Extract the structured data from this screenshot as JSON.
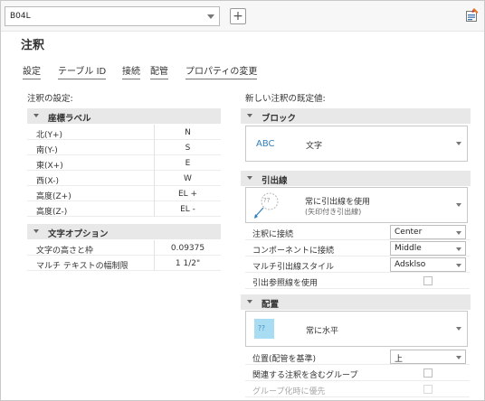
{
  "header": {
    "style_dropdown_value": "B04L",
    "add_button_label": "+",
    "corner_icon": "annotation-style-icon"
  },
  "title": "注釈",
  "tabs": [
    "設定",
    "テーブル ID",
    "接続",
    "配管",
    "プロパティの変更"
  ],
  "left": {
    "heading": "注釈の設定:",
    "coord_label_header": "座標ラベル",
    "coord_rows": [
      {
        "label": "北(Y+)",
        "value": "N"
      },
      {
        "label": "南(Y-)",
        "value": "S"
      },
      {
        "label": "東(X+)",
        "value": "E"
      },
      {
        "label": "西(X-)",
        "value": "W"
      },
      {
        "label": "高度(Z+)",
        "value": "EL +"
      },
      {
        "label": "高度(Z-)",
        "value": "EL -"
      }
    ],
    "text_options_header": "文字オプション",
    "text_rows": [
      {
        "label": "文字の高さと枠",
        "value": "0.09375"
      },
      {
        "label": "マルチ テキストの幅制限",
        "value": "1 1/2\""
      }
    ]
  },
  "right": {
    "heading": "新しい注釈の既定値:",
    "block": {
      "header": "ブロック",
      "preview_text": "ABC",
      "selected": "文字"
    },
    "leader": {
      "header": "引出線",
      "preview_text": "??",
      "selected_title": "常に引出線を使用",
      "selected_subtitle": "(矢印付き引出線)",
      "props": [
        {
          "label": "注釈に接続",
          "type": "select",
          "value": "Center"
        },
        {
          "label": "コンポーネントに接続",
          "type": "select",
          "value": "Middle"
        },
        {
          "label": "マルチ引出線スタイル",
          "type": "select",
          "value": "Adsklso"
        },
        {
          "label": "引出参照線を使用",
          "type": "checkbox",
          "checked": false
        }
      ]
    },
    "placement": {
      "header": "配置",
      "preview_text": "??",
      "selected": "常に水平",
      "props": [
        {
          "label": "位置(配管を基準)",
          "type": "select",
          "value": "上"
        },
        {
          "label": "関連する注釈を含むグループ",
          "type": "checkbox",
          "checked": false
        },
        {
          "label": "グループ化時に優先",
          "type": "checkbox",
          "checked": false,
          "disabled": true
        }
      ]
    }
  },
  "colors": {
    "accent": "#2f7fbf",
    "category_header_bg": "#e8e8e8",
    "preview_tile": "#a8dcf3"
  }
}
